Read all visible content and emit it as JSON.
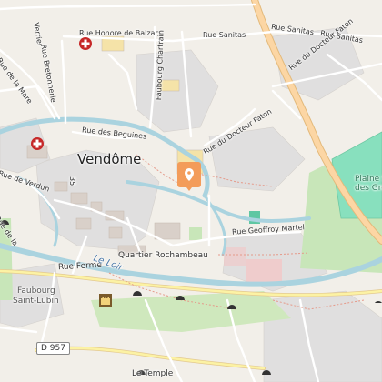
{
  "map": {
    "labels": {
      "vendome": "Vendôme",
      "rue_honore_de_balzac": "Rue Honore de Balzac",
      "rue_sanitas": "Rue Sanitas",
      "rue_sanitas_2": "Rue Sanitas",
      "rue_sanitas_3": "Rue Sanitas",
      "rue_du_docteur_faton_ne": "Rue du Docteur Faton",
      "rue_du_docteur_faton": "Rue du Docteur Faton",
      "rue_des_beguines": "Rue des Beguines",
      "rue_de_la_mare": "Rue de la Mare",
      "rue_bretonnerie": "Rue Bretonnerie",
      "faubourg_chartrain": "Faubourg Chartrain",
      "rue_de_verdun": "Rue de Verdun",
      "rue_geoffroy_martel": "Rue Geoffroy Martel",
      "quartier_rochambeau": "Quartier Rochambeau",
      "rue_ferme": "Rue Ferme",
      "le_loir": "Le Loir",
      "faubourg_saint_lubin_1": "Faubourg",
      "faubourg_saint_lubin_2": "Saint-Lubin",
      "le_temple": "Le Temple",
      "verrier": "Verrier",
      "rue_de_la_mare_s": "Rue de la",
      "ave_35": "35",
      "plaine_sports": "Plaine Sports des Gros Pré",
      "road_shield_d957": "D 957"
    },
    "colors": {
      "background": "#f2efe9",
      "water": "#aad3df",
      "river": "#aad3df",
      "main_road": "#fcd6a4",
      "park": "#c8e6b9",
      "sport": "#88e0be",
      "residential": "#e0dfdf",
      "marker": "#f39c5a",
      "hospital": "#c62828"
    },
    "icons": [
      "hospital-icon",
      "location-pin-icon",
      "castle-icon",
      "tunnel-icon"
    ]
  }
}
